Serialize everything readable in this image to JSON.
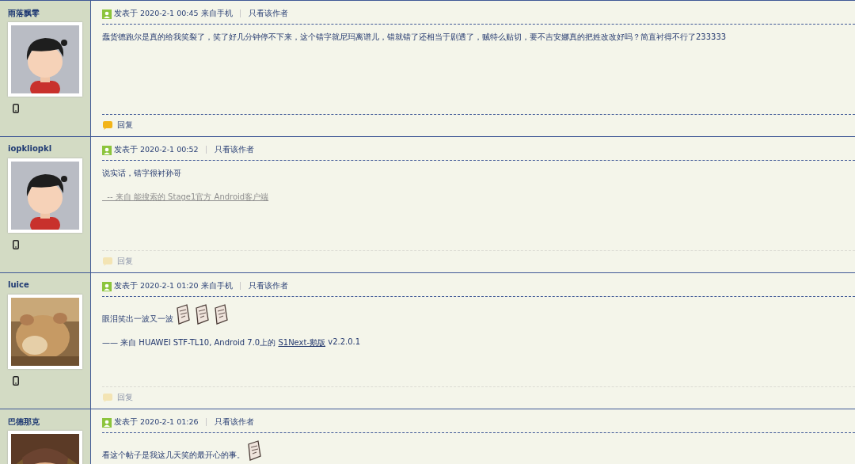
{
  "posts": [
    {
      "author": "雨落飘零",
      "avatar": {
        "kind": "picture"
      },
      "mobile": true,
      "meta": "发表于 2020-2-1 00:45 来自手机",
      "author_only": "只看该作者",
      "content": [
        {
          "kind": "text",
          "text": "蠢货德跑尔是真的给我笑裂了，笑了好几分钟停不下来，这个错字就尼玛离谱儿，错就错了还相当于剧透了，贼特么贴切，要不吉安娜真的把姓改改好吗？简直衬得不行了233333"
        }
      ],
      "reply": {
        "label": "回复",
        "active": true
      }
    },
    {
      "author": "iopkliopkl",
      "avatar": {
        "kind": "picture"
      },
      "mobile": true,
      "meta": "发表于 2020-2-1 00:52",
      "author_only": "只看该作者",
      "content": [
        {
          "kind": "text",
          "text": "说实话，错字很衬孙哥"
        }
      ],
      "signature": {
        "kind": "link",
        "text": "  -- 来自 能搜索的 Stage1官方 Android客户端"
      },
      "reply": {
        "label": "回复",
        "active": false
      }
    },
    {
      "author": "luice",
      "avatar": {
        "kind": "picture"
      },
      "mobile": true,
      "meta": "发表于 2020-2-1 01:20 来自手机",
      "author_only": "只看该作者",
      "content": [
        {
          "kind": "text",
          "text": "眼泪笑出一波又一波"
        },
        {
          "kind": "emoticon"
        },
        {
          "kind": "emoticon"
        },
        {
          "kind": "emoticon"
        }
      ],
      "signature": {
        "kind": "mixed",
        "before": "—— 来自 HUAWEI STF-TL10, Android 7.0上的 ",
        "link": "S1Next-鹅版",
        "after": " v2.2.0.1"
      },
      "reply": {
        "label": "回复",
        "active": false
      }
    },
    {
      "author": "巴德那克",
      "avatar": {
        "kind": "picture"
      },
      "meta": "发表于 2020-2-1 01:26",
      "author_only": "只看该作者",
      "content": [
        {
          "kind": "text",
          "text": "看这个帖子是我这几天笑的最开心的事。"
        },
        {
          "kind": "emoticon"
        }
      ]
    }
  ]
}
